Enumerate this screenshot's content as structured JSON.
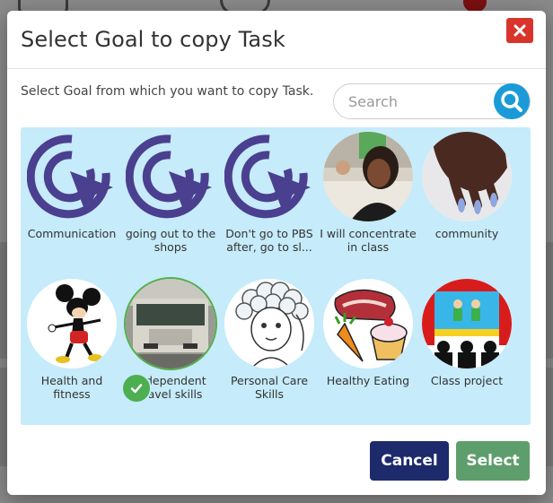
{
  "modal": {
    "title": "Select Goal to copy Task",
    "instruction": "Select Goal from which you want to copy Task.",
    "close_icon": "close-icon"
  },
  "search": {
    "placeholder": "Search",
    "value": ""
  },
  "goals": [
    {
      "label": "Communication",
      "image": "cursor-icon",
      "selected": false
    },
    {
      "label": "going out to the shops",
      "image": "cursor-icon",
      "selected": false
    },
    {
      "label": "Don't go to PBS after, go to sl...",
      "image": "cursor-icon",
      "selected": false
    },
    {
      "label": "I will concentrate in class",
      "image": "photo-student",
      "selected": false
    },
    {
      "label": "community",
      "image": "photo-hand",
      "selected": false
    },
    {
      "label": "Health and fitness",
      "image": "cartoon-mouse",
      "selected": false
    },
    {
      "label": "Independent travel skills",
      "image": "photo-bus",
      "selected": true
    },
    {
      "label": "Personal Care Skills",
      "image": "shampoo-symbol",
      "selected": false
    },
    {
      "label": "Healthy Eating",
      "image": "food-symbol",
      "selected": false
    },
    {
      "label": "Class project",
      "image": "stage-symbol",
      "selected": false
    }
  ],
  "buttons": {
    "cancel": "Cancel",
    "select": "Select"
  },
  "colors": {
    "close": "#d9342b",
    "search": "#1a9bd7",
    "panel": "#c6ebfa",
    "cursor_icon": "#4b3f8f",
    "cancel": "#1d2a6b",
    "select": "#5e9e6d",
    "check": "#4caf50"
  }
}
